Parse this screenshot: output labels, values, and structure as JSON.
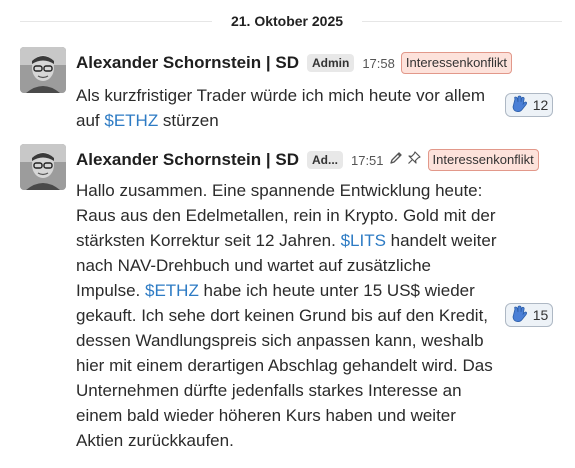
{
  "date_divider": "21. Oktober 2025",
  "messages": [
    {
      "author": "Alexander Schornstein | SD",
      "role": "Admin",
      "time": "17:58",
      "conflict": "Interessenkonflikt",
      "text": {
        "p1": "Als kurzfristiger Trader würde ich mich heute vor allem\nauf ",
        "t1": "$ETHZ",
        "p2": " stürzen"
      },
      "reaction": {
        "icon": "waving-hand-icon",
        "count": "12"
      }
    },
    {
      "author": "Alexander Schornstein | SD",
      "role": "Ad...",
      "time": "17:51",
      "edited_icons": [
        "pencil-icon",
        "pin-icon"
      ],
      "conflict": "Interessenkonflikt",
      "text": {
        "p1": "Hallo zusammen. Eine spannende Entwicklung heute:\nRaus aus den Edelmetallen, rein in Krypto. Gold mit der\nstärksten Korrektur seit 12 Jahren. ",
        "t1": "$LITS",
        "p2": " handelt weiter\nnach NAV-Drehbuch und wartet auf zusätzliche\nImpulse. ",
        "t2": "$ETHZ",
        "p3": " habe ich heute unter 15 US$ wieder\ngekauft. Ich sehe dort keinen Grund bis auf den Kredit,\ndessen Wandlungspreis sich anpassen kann, weshalb\nhier mit einem derartigen Abschlag gehandelt wird. Das\nUnternehmen dürfte jedenfalls starkes Interesse an\neinem bald wieder höheren Kurs haben und weiter\nAktien zurückkaufen."
      },
      "reaction": {
        "icon": "waving-hand-icon",
        "count": "15"
      }
    }
  ]
}
